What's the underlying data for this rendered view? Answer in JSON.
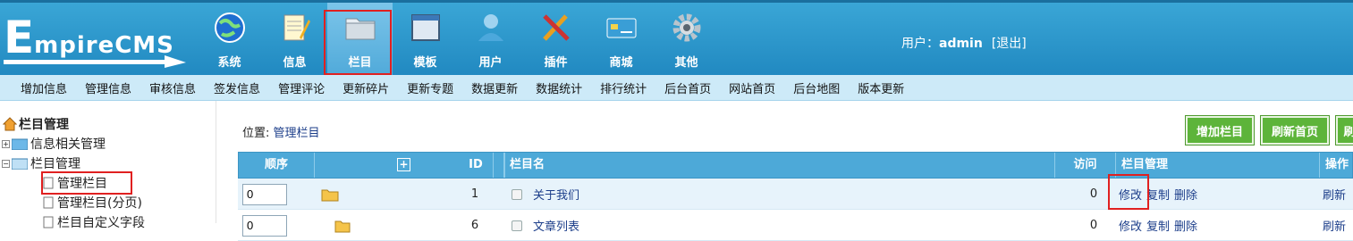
{
  "logo": {
    "text_big": "E",
    "text_small": "mpireCMS"
  },
  "nav": [
    {
      "label": "系统",
      "icon": "globe-icon"
    },
    {
      "label": "信息",
      "icon": "notepad-icon"
    },
    {
      "label": "栏目",
      "icon": "folder-icon"
    },
    {
      "label": "模板",
      "icon": "window-icon"
    },
    {
      "label": "用户",
      "icon": "user-icon"
    },
    {
      "label": "插件",
      "icon": "tools-icon"
    },
    {
      "label": "商城",
      "icon": "card-icon"
    },
    {
      "label": "其他",
      "icon": "gear-icon"
    }
  ],
  "user": {
    "prefix": "用户：",
    "name": "admin",
    "logout": "[退出]"
  },
  "submenu": [
    "增加信息",
    "管理信息",
    "审核信息",
    "签发信息",
    "管理评论",
    "更新碎片",
    "更新专题",
    "数据更新",
    "数据统计",
    "排行统计",
    "后台首页",
    "网站首页",
    "后台地图",
    "版本更新"
  ],
  "sidebar": {
    "title": "栏目管理",
    "items": [
      "信息相关管理",
      "栏目管理",
      "管理栏目",
      "管理栏目(分页)",
      "栏目自定义字段"
    ]
  },
  "location": {
    "label": "位置: ",
    "link": "管理栏目"
  },
  "buttons": {
    "add": "增加栏目",
    "refresh_home": "刷新首页",
    "partial": "刷"
  },
  "table": {
    "headers": {
      "order": "顺序",
      "expand": "+",
      "id": "ID",
      "name": "栏目名",
      "visits": "访问",
      "manage": "栏目管理",
      "ops": "操作"
    },
    "rows": [
      {
        "order": "0",
        "id": "1",
        "name": "关于我们",
        "visits": "0",
        "edit": "修改",
        "copy": "复制",
        "delete": "删除",
        "refresh": "刷新"
      },
      {
        "order": "0",
        "id": "6",
        "name": "文章列表",
        "visits": "0",
        "edit": "修改",
        "copy": "复制",
        "delete": "删除",
        "refresh": "刷新"
      }
    ]
  },
  "colors": {
    "header": "#2a97cc",
    "submenu": "#cdeaf8",
    "button": "#5db43a",
    "highlight": "#e02020"
  }
}
